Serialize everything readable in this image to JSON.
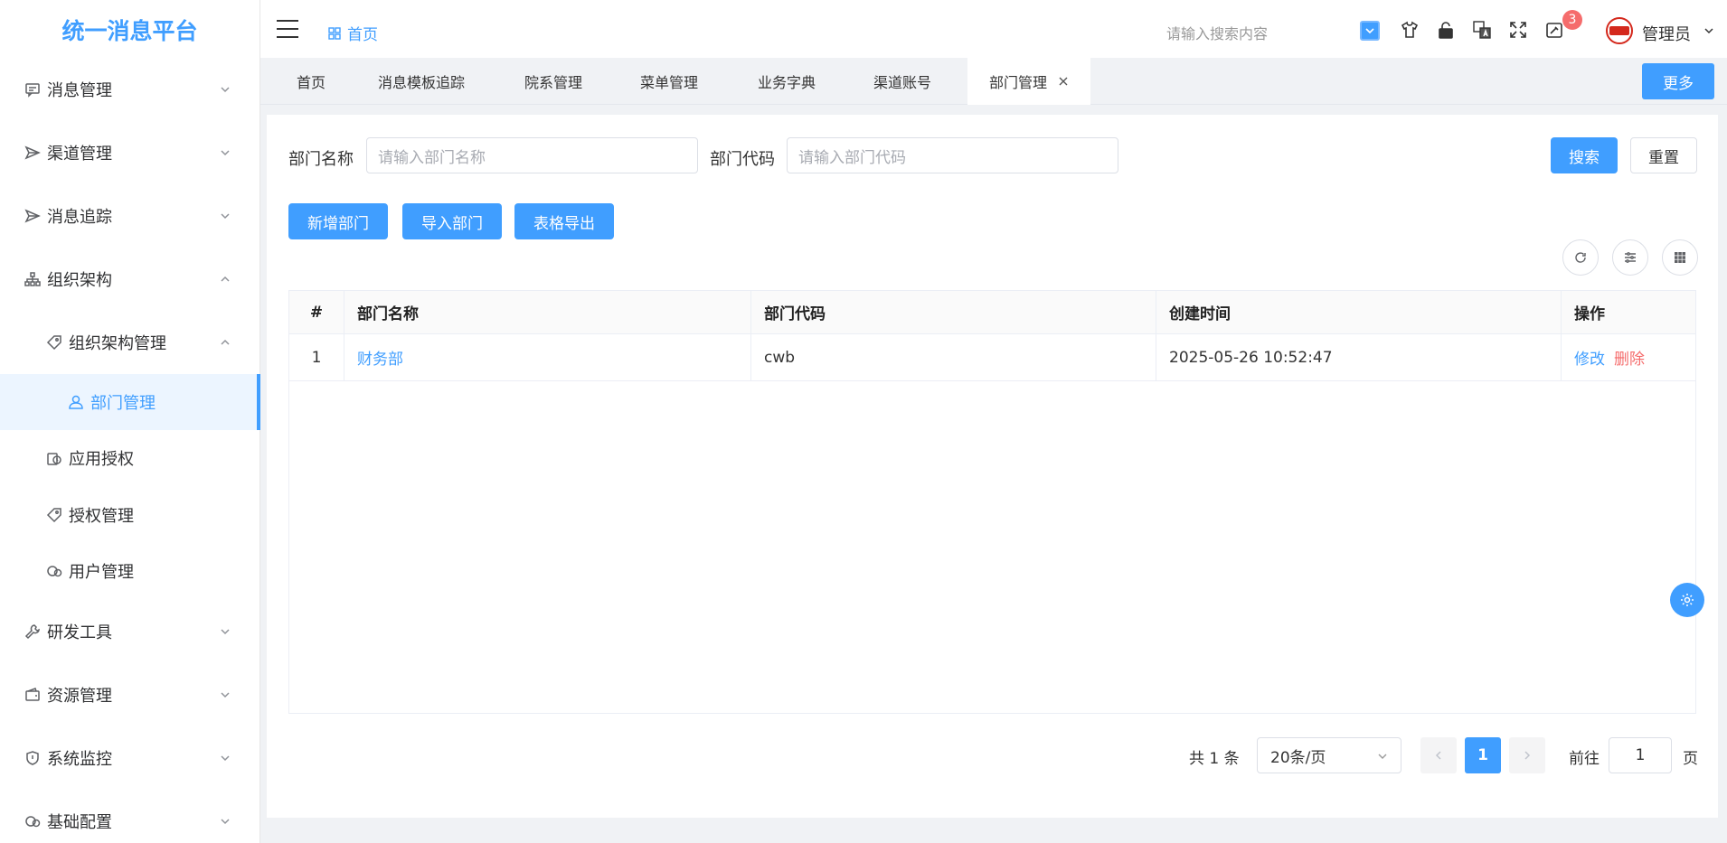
{
  "app": {
    "title": "统一消息平台"
  },
  "sidebar": {
    "items": [
      {
        "label": "消息管理",
        "icon": "message-icon"
      },
      {
        "label": "渠道管理",
        "icon": "send-icon"
      },
      {
        "label": "消息追踪",
        "icon": "send-icon"
      },
      {
        "label": "组织架构",
        "icon": "org-tree-icon"
      },
      {
        "label": "组织架构管理",
        "icon": "tag-icon"
      },
      {
        "label": "部门管理",
        "icon": "user-icon"
      },
      {
        "label": "应用授权",
        "icon": "app-auth-icon"
      },
      {
        "label": "授权管理",
        "icon": "tag-icon"
      },
      {
        "label": "用户管理",
        "icon": "user-circle-icon"
      },
      {
        "label": "研发工具",
        "icon": "wrench-icon"
      },
      {
        "label": "资源管理",
        "icon": "wallet-icon"
      },
      {
        "label": "系统监控",
        "icon": "shield-icon"
      },
      {
        "label": "基础配置",
        "icon": "config-icon"
      }
    ]
  },
  "header": {
    "breadcrumb": "首页",
    "search_placeholder": "请输入搜索内容",
    "notification_count": "3",
    "user_name": "管理员"
  },
  "tabs": {
    "items": [
      "首页",
      "消息模板追踪",
      "院系管理",
      "菜单管理",
      "业务字典",
      "渠道账号",
      "部门管理"
    ],
    "more": "更多"
  },
  "filter": {
    "dept_name_label": "部门名称",
    "dept_name_placeholder": "请输入部门名称",
    "dept_code_label": "部门代码",
    "dept_code_placeholder": "请输入部门代码",
    "search": "搜索",
    "reset": "重置"
  },
  "toolbar": {
    "add": "新增部门",
    "import": "导入部门",
    "export": "表格导出"
  },
  "table": {
    "columns": [
      "#",
      "部门名称",
      "部门代码",
      "创建时间",
      "操作"
    ],
    "rows": [
      {
        "index": "1",
        "name": "财务部",
        "code": "cwb",
        "created": "2025-05-26 10:52:47",
        "edit": "修改",
        "delete": "删除"
      }
    ]
  },
  "pagination": {
    "total": "共 1 条",
    "page_size": "20条/页",
    "current": "1",
    "goto_label": "前往",
    "goto_value": "1",
    "page_suffix": "页"
  },
  "colors": {
    "primary": "#409eff",
    "danger": "#f56c6c"
  }
}
